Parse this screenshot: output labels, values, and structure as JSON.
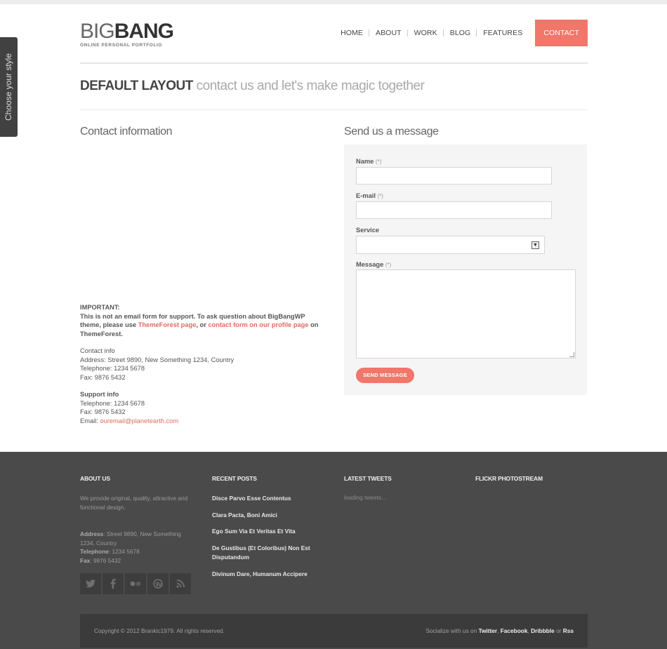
{
  "header": {
    "logo_big": "BIG",
    "logo_bang": "BANG",
    "logo_tagline": "ONLINE PERSONAL PORTFOLIO",
    "nav": [
      "HOME",
      "ABOUT",
      "WORK",
      "BLOG",
      "FEATURES",
      "CONTACT"
    ],
    "active_nav": "CONTACT"
  },
  "side_tab": {
    "label": "Choose your style"
  },
  "page": {
    "headline_strong": "DEFAULT LAYOUT",
    "headline_light": "contact us and let's make magic together"
  },
  "contact": {
    "title": "Contact information",
    "important_label": "IMPORTANT:",
    "important_text_1": "This is not an email form for support. To ask question about BigBangWP theme, please use",
    "important_link_1": "ThemeForest page",
    "important_text_2": ", or",
    "important_link_2": "contact form on our profile page",
    "important_text_3": "on ThemeForest.",
    "contact_info_label": "Contact info",
    "address": "Address: Street 9890, New Something 1234, Country",
    "telephone": "Telephone: 1234 5678",
    "fax": "Fax: 9876 5432",
    "support_label": "Support info",
    "support_telephone": "Telephone: 1234 5678",
    "support_fax": "Fax: 9876 5432",
    "email_label": "Email:",
    "email": "ouremail@planetearth.com"
  },
  "form": {
    "title": "Send us a message",
    "name_label": "Name",
    "required_mark": "(*)",
    "email_label": "E-mail",
    "service_label": "Service",
    "service_value": "",
    "message_label": "Message",
    "name_value": "",
    "email_value": "",
    "message_value": "",
    "submit_label": "SEND MESSAGE"
  },
  "footer": {
    "about_title": "ABOUT US",
    "about_text": "We provide original, quality, attractive and functional design.",
    "address_label": "Address",
    "address_value": ": Street 9890, New Something 1234, Country",
    "telephone_label": "Telephone",
    "telephone_value": ": 1234 5678",
    "fax_label": "Fax",
    "fax_value": ": 9876 5432",
    "social_icons": [
      "twitter-icon",
      "facebook-icon",
      "flickr-icon",
      "wordpress-icon",
      "rss-icon"
    ],
    "recent_title": "RECENT POSTS",
    "recent_posts": [
      "Disce Parvo Esse Contentus",
      "Clara Pacta, Boni Amici",
      "Ego Sum Via Et Veritas Et Vita",
      "De Gustibus (Et Coloribus) Non Est Disputandum",
      "Divinum Dare, Humanum Accipere"
    ],
    "tweets_title": "LATEST TWEETS",
    "tweets_text": "loading tweets...",
    "flickr_title": "FLICKR PHOTOSTREAM",
    "copyright": "Copyright © 2012 Brankic1979. All rights reserved.",
    "socialize_prefix": "Socialize with us on",
    "socialize_links": [
      "Twitter",
      "Facebook",
      "Dribbble",
      "Rss"
    ],
    "socialize_or": "or"
  },
  "colors": {
    "accent": "#f0776a",
    "footer_bg": "#4a4a4a",
    "footer_bar_bg": "#3b3b3b"
  }
}
